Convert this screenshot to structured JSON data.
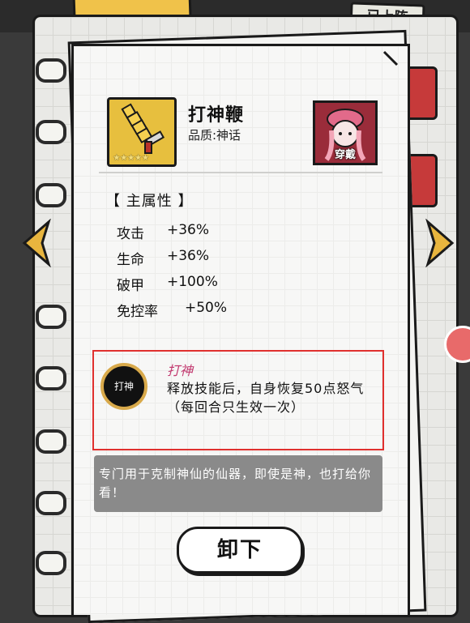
{
  "header": {
    "status_badge": "已上阵"
  },
  "item": {
    "name": "打神鞭",
    "quality": "品质:神话",
    "stars": 5,
    "equipped_hero_label": "穿戴"
  },
  "main_attributes": {
    "title": "【 主属性 】",
    "rows": [
      {
        "name": "攻击",
        "value": "+36%"
      },
      {
        "name": "生命",
        "value": "+36%"
      },
      {
        "name": "破甲",
        "value": "+100%"
      },
      {
        "name": "免控率",
        "value": "+50%"
      }
    ]
  },
  "skill": {
    "icon_label": "打神",
    "name": "打神",
    "description": "释放技能后，自身恢复50点怒气（每回合只生效一次）"
  },
  "flavor_text": "专门用于克制神仙的仙器，即使是神，也打给你看！",
  "actions": {
    "unequip_label": "卸下"
  },
  "colors": {
    "skill_name": "#c23a70",
    "highlight_border": "#e0302e",
    "item_frame": "#e7bf3e"
  }
}
